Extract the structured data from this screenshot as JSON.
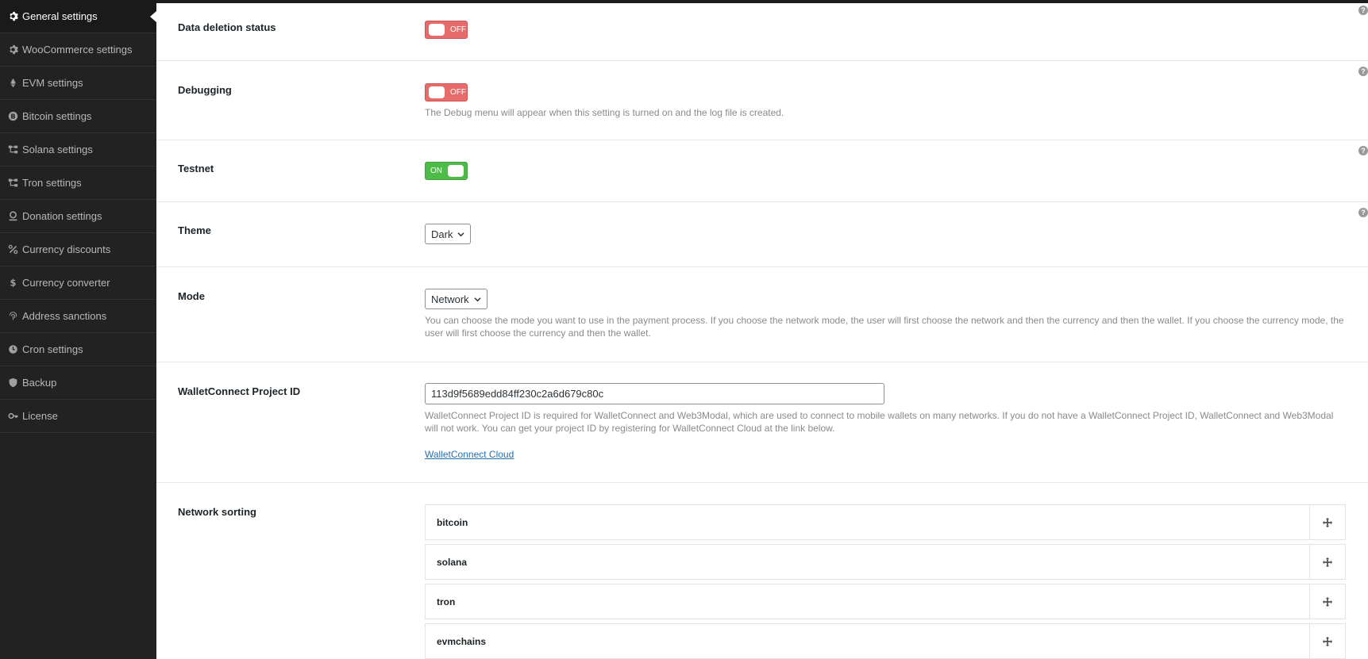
{
  "sidebar": {
    "items": [
      {
        "label": "General settings",
        "icon": "gear-icon",
        "active": true
      },
      {
        "label": "WooCommerce settings",
        "icon": "gear-icon"
      },
      {
        "label": "EVM settings",
        "icon": "ethereum-icon"
      },
      {
        "label": "Bitcoin settings",
        "icon": "bitcoin-icon"
      },
      {
        "label": "Solana settings",
        "icon": "network-icon"
      },
      {
        "label": "Tron settings",
        "icon": "network-icon"
      },
      {
        "label": "Donation settings",
        "icon": "donation-icon"
      },
      {
        "label": "Currency discounts",
        "icon": "percent-icon"
      },
      {
        "label": "Currency converter",
        "icon": "dollar-icon"
      },
      {
        "label": "Address sanctions",
        "icon": "fingerprint-icon"
      },
      {
        "label": "Cron settings",
        "icon": "clock-icon"
      },
      {
        "label": "Backup",
        "icon": "shield-icon"
      },
      {
        "label": "License",
        "icon": "key-icon"
      }
    ]
  },
  "settings": {
    "data_deletion": {
      "label": "Data deletion status",
      "state": "OFF"
    },
    "debugging": {
      "label": "Debugging",
      "state": "OFF",
      "description": "The Debug menu will appear when this setting is turned on and the log file is created."
    },
    "testnet": {
      "label": "Testnet",
      "state": "ON"
    },
    "theme": {
      "label": "Theme",
      "value": "Dark"
    },
    "mode": {
      "label": "Mode",
      "value": "Network",
      "description": "You can choose the mode you want to use in the payment process. If you choose the network mode, the user will first choose the network and then the currency and then the wallet. If you choose the currency mode, the user will first choose the currency and then the wallet."
    },
    "walletconnect": {
      "label": "WalletConnect Project ID",
      "value": "113d9f5689edd84ff230c2a6d679c80c",
      "description": "WalletConnect Project ID is required for WalletConnect and Web3Modal, which are used to connect to mobile wallets on many networks. If you do not have a WalletConnect Project ID, WalletConnect and Web3Modal will not work. You can get your project ID by registering for WalletConnect Cloud at the link below.",
      "link": "WalletConnect Cloud"
    },
    "network_sorting": {
      "label": "Network sorting",
      "items": [
        "bitcoin",
        "solana",
        "tron",
        "evmchains"
      ]
    }
  },
  "help_glyph": "?",
  "colors": {
    "toggle_off": "#e66b6b",
    "toggle_on": "#4cbb47",
    "sidebar_bg": "#222222",
    "link": "#2271b1"
  }
}
